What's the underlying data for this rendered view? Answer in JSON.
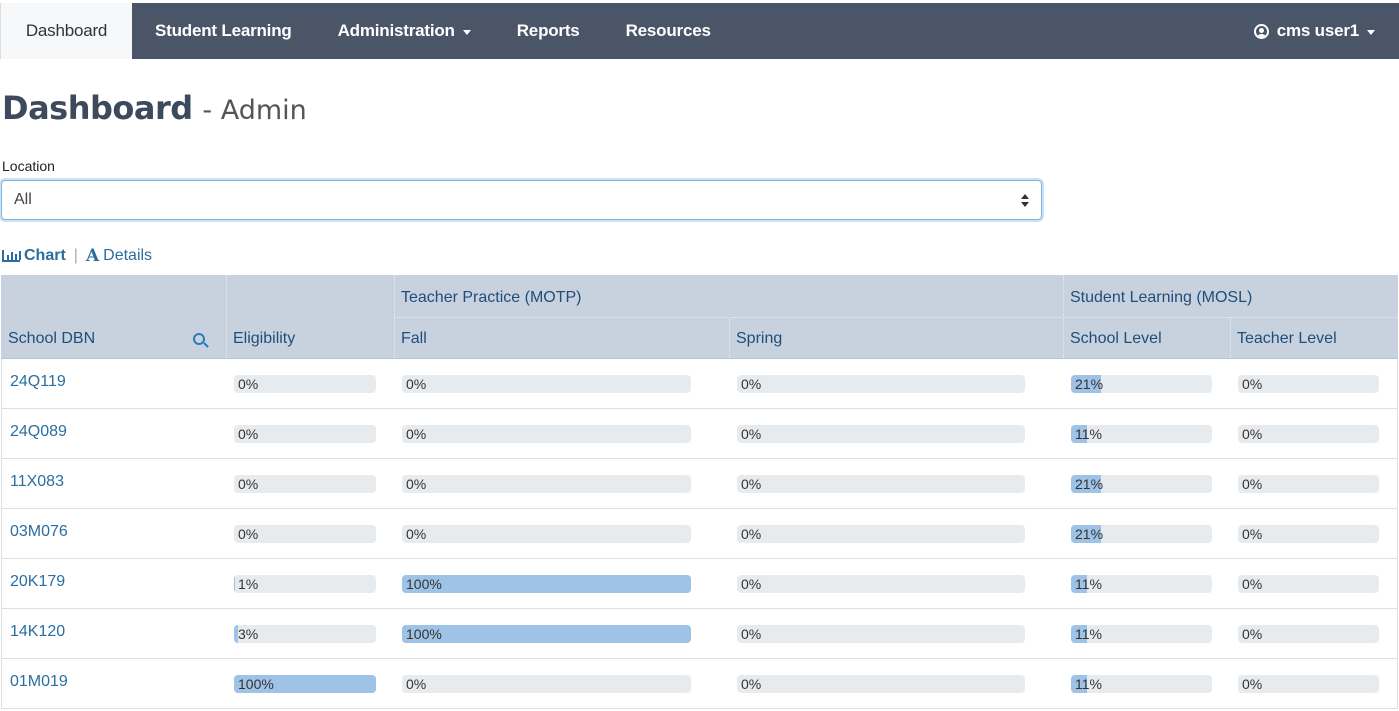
{
  "nav": {
    "items": [
      {
        "label": "Dashboard",
        "active": true,
        "dropdown": false
      },
      {
        "label": "Student Learning",
        "active": false,
        "dropdown": false
      },
      {
        "label": "Administration",
        "active": false,
        "dropdown": true
      },
      {
        "label": "Reports",
        "active": false,
        "dropdown": false
      },
      {
        "label": "Resources",
        "active": false,
        "dropdown": false
      }
    ],
    "user": "cms user1"
  },
  "page": {
    "title": "Dashboard",
    "subtitle": "- Admin",
    "location_label": "Location",
    "location_value": "All",
    "view_chart": "Chart",
    "view_details": "Details"
  },
  "table": {
    "header_group_motp": "Teacher Practice (MOTP)",
    "header_group_mosl": "Student Learning (MOSL)",
    "columns": {
      "dbn": "School DBN",
      "eligibility": "Eligibility",
      "fall": "Fall",
      "spring": "Spring",
      "school_level": "School Level",
      "teacher_level": "Teacher Level"
    },
    "rows": [
      {
        "dbn": "24Q119",
        "eligibility": 0,
        "fall": 0,
        "spring": 0,
        "school_level": 21,
        "teacher_level": 0
      },
      {
        "dbn": "24Q089",
        "eligibility": 0,
        "fall": 0,
        "spring": 0,
        "school_level": 11,
        "teacher_level": 0
      },
      {
        "dbn": "11X083",
        "eligibility": 0,
        "fall": 0,
        "spring": 0,
        "school_level": 21,
        "teacher_level": 0
      },
      {
        "dbn": "03M076",
        "eligibility": 0,
        "fall": 0,
        "spring": 0,
        "school_level": 21,
        "teacher_level": 0
      },
      {
        "dbn": "20K179",
        "eligibility": 1,
        "fall": 100,
        "spring": 0,
        "school_level": 11,
        "teacher_level": 0
      },
      {
        "dbn": "14K120",
        "eligibility": 3,
        "fall": 100,
        "spring": 0,
        "school_level": 11,
        "teacher_level": 0
      },
      {
        "dbn": "01M019",
        "eligibility": 100,
        "fall": 0,
        "spring": 0,
        "school_level": 11,
        "teacher_level": 0
      }
    ]
  },
  "colors": {
    "navbar": "#4a5568",
    "header": "#c8d2df",
    "bar_track": "#e8ebee",
    "bar_fill": "#9ec3e6",
    "link": "#2a6ea0"
  }
}
